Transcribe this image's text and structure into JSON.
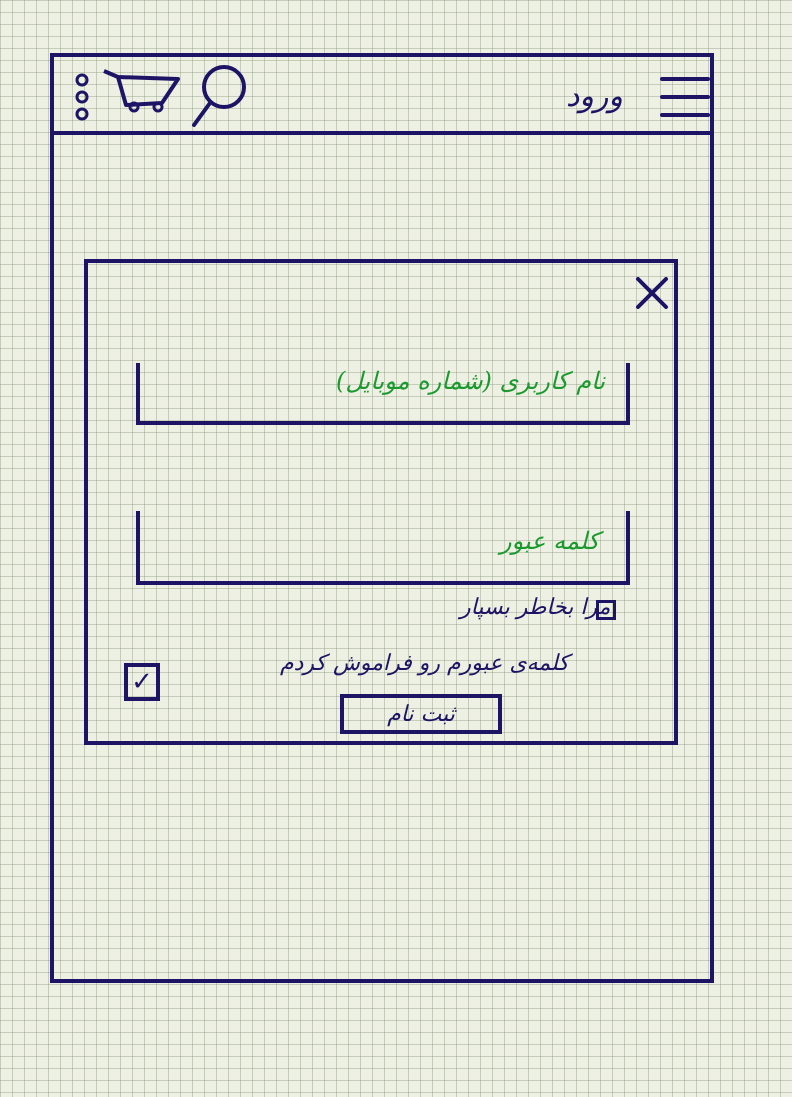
{
  "header": {
    "title": "ورود",
    "icons": [
      "more-vertical-icon",
      "cart-icon",
      "search-icon",
      "menu-icon"
    ]
  },
  "login_dialog": {
    "username_placeholder": "نام کاربری (شماره موبایل)",
    "password_placeholder": "کلمه عبور",
    "remember_me_label": "مرا بخاطر بسپار",
    "forgot_password_label": "کلمه‌ی عبورم رو فراموش کردم",
    "submit_label": "ثبت نام",
    "checkbox_mark": "✓"
  },
  "colors": {
    "ink": "#1d1466",
    "placeholder": "#1a9a2e"
  }
}
